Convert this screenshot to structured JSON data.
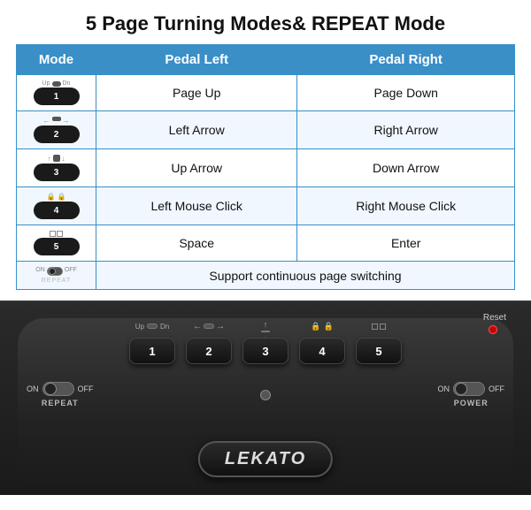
{
  "title": "5 Page Turning Modes& REPEAT Mode",
  "table": {
    "headers": [
      "Mode",
      "Pedal Left",
      "Pedal Right"
    ],
    "rows": [
      {
        "mode_num": "1",
        "mode_label": "1",
        "pedal_left": "Page Up",
        "pedal_right": "Page Down"
      },
      {
        "mode_num": "2",
        "mode_label": "2",
        "pedal_left": "Left Arrow",
        "pedal_right": "Right Arrow"
      },
      {
        "mode_num": "3",
        "mode_label": "3",
        "pedal_left": "Up Arrow",
        "pedal_right": "Down Arrow"
      },
      {
        "mode_num": "4",
        "mode_label": "4",
        "pedal_left": "Left Mouse Click",
        "pedal_right": "Right Mouse Click"
      },
      {
        "mode_num": "5",
        "mode_label": "5",
        "pedal_left": "Space",
        "pedal_right": "Enter"
      },
      {
        "mode_num": "R",
        "mode_label": "REPEAT",
        "pedal_left": "Support continuous page switching",
        "pedal_right": ""
      }
    ]
  },
  "device": {
    "buttons": [
      "1",
      "2",
      "3",
      "4",
      "5"
    ],
    "repeat_label": "REPEAT",
    "power_label": "POWER",
    "on_label": "ON",
    "off_label": "OFF",
    "logo": "LEKATO",
    "reset_label": "Reset"
  }
}
